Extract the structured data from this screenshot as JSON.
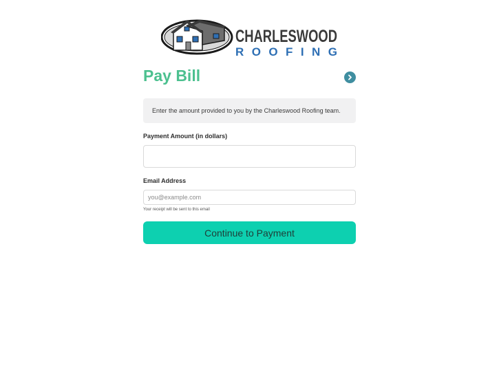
{
  "brand": {
    "name_top": "CHARLESWOOD",
    "name_bottom": "ROOFING"
  },
  "page": {
    "title": "Pay Bill",
    "next_icon": "chevron-right-icon",
    "info_text": "Enter the amount provided to you by the Charleswood Roofing team."
  },
  "form": {
    "amount_label": "Payment Amount (in dollars)",
    "amount_value": "",
    "email_label": "Email Address",
    "email_value": "",
    "email_placeholder": "you@example.com",
    "email_help": "Your receipt will be sent to this email",
    "submit_label": "Continue to Payment"
  },
  "colors": {
    "accent_title": "#4cc08f",
    "button": "#0dd0b0",
    "next_circle": "#3f8ea0",
    "brand_dark": "#3a3a3a",
    "brand_blue": "#2e6fb4"
  }
}
